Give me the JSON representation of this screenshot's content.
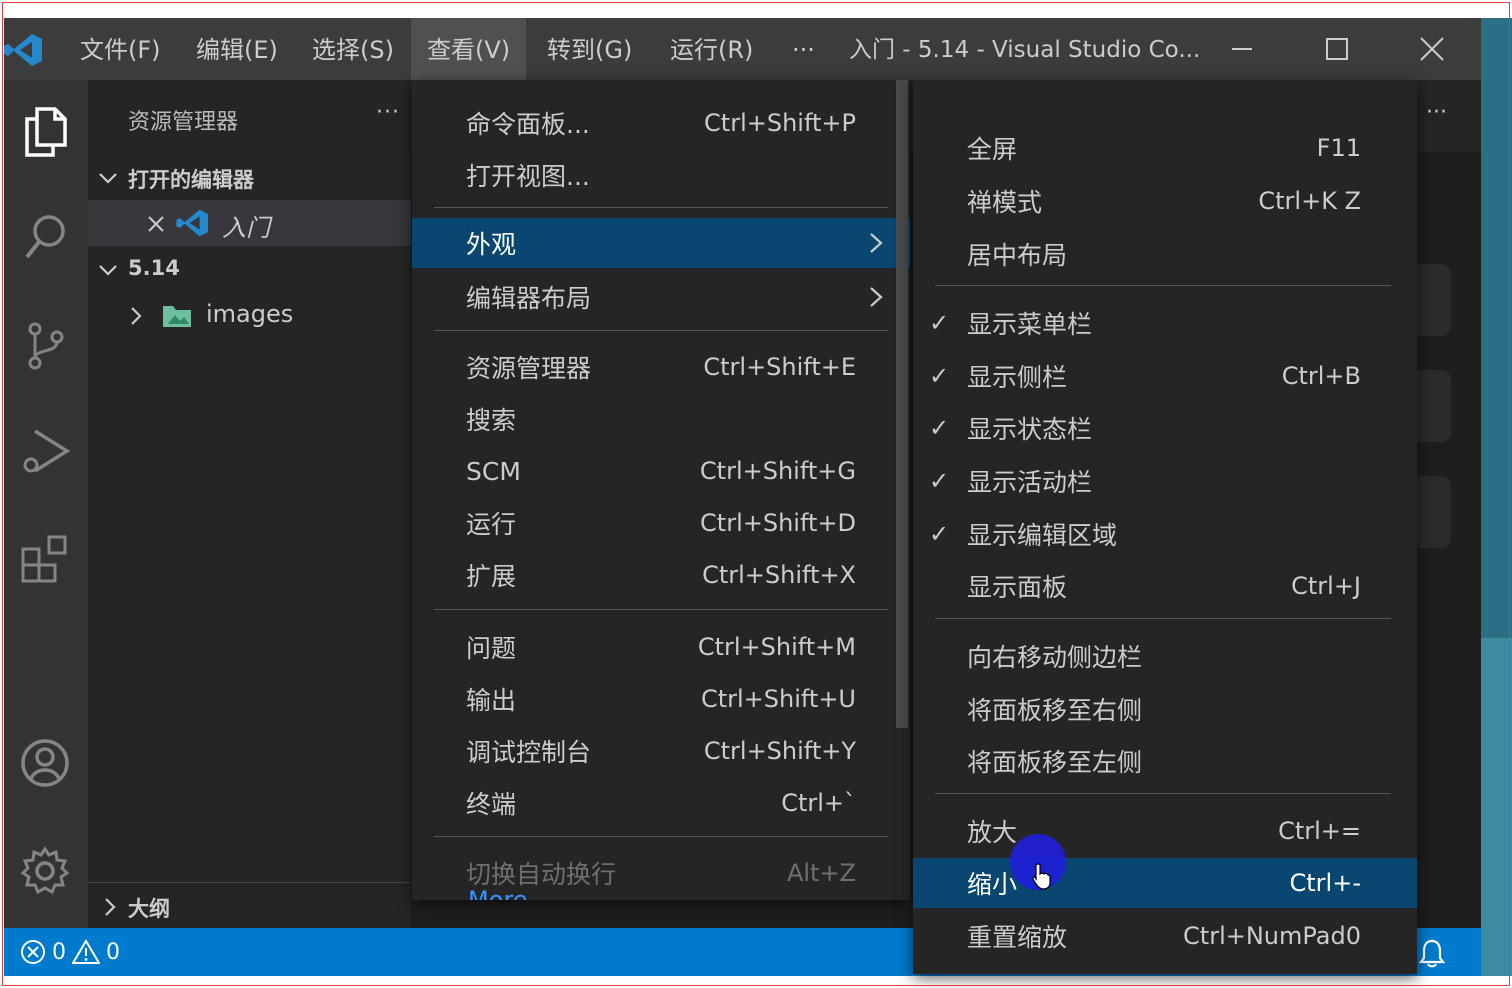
{
  "titlebar": {
    "menus": [
      "文件(F)",
      "编辑(E)",
      "选择(S)",
      "查看(V)",
      "转到(G)",
      "运行(R)"
    ],
    "overflow": "···",
    "title": "入门 - 5.14 - Visual Studio Co..."
  },
  "sidebar": {
    "title": "资源管理器",
    "more": "···",
    "open_editors_label": "打开的编辑器",
    "open_editor_file": "入门",
    "folder_label": "5.14",
    "tree_item": "images",
    "outline_label": "大纲"
  },
  "editor": {
    "more": "···"
  },
  "statusbar": {
    "errors": "0",
    "warnings": "0"
  },
  "view_menu": {
    "items": [
      {
        "label": "命令面板...",
        "key": "Ctrl+Shift+P"
      },
      {
        "label": "打开视图...",
        "key": ""
      },
      {
        "label": "外观",
        "key": "",
        "submenu": true,
        "highlighted": true
      },
      {
        "label": "编辑器布局",
        "key": "",
        "submenu": true
      },
      {
        "label": "资源管理器",
        "key": "Ctrl+Shift+E"
      },
      {
        "label": "搜索",
        "key": ""
      },
      {
        "label": "SCM",
        "key": "Ctrl+Shift+G"
      },
      {
        "label": "运行",
        "key": "Ctrl+Shift+D"
      },
      {
        "label": "扩展",
        "key": "Ctrl+Shift+X"
      },
      {
        "label": "问题",
        "key": "Ctrl+Shift+M"
      },
      {
        "label": "输出",
        "key": "Ctrl+Shift+U"
      },
      {
        "label": "调试控制台",
        "key": "Ctrl+Shift+Y"
      },
      {
        "label": "终端",
        "key": "Ctrl+`"
      },
      {
        "label": "切换自动换行",
        "key": "Alt+Z",
        "disabled": true
      }
    ],
    "peek_text": "More..."
  },
  "appearance_menu": {
    "items": [
      {
        "label": "全屏",
        "key": "F11",
        "checked": false
      },
      {
        "label": "禅模式",
        "key": "Ctrl+K Z",
        "checked": false
      },
      {
        "label": "居中布局",
        "key": "",
        "checked": false
      },
      {
        "label": "显示菜单栏",
        "key": "",
        "checked": true
      },
      {
        "label": "显示侧栏",
        "key": "Ctrl+B",
        "checked": true
      },
      {
        "label": "显示状态栏",
        "key": "",
        "checked": true
      },
      {
        "label": "显示活动栏",
        "key": "",
        "checked": true
      },
      {
        "label": "显示编辑区域",
        "key": "",
        "checked": true
      },
      {
        "label": "显示面板",
        "key": "Ctrl+J",
        "checked": false
      },
      {
        "label": "向右移动侧边栏",
        "key": "",
        "checked": false
      },
      {
        "label": "将面板移至右侧",
        "key": "",
        "checked": false
      },
      {
        "label": "将面板移至左侧",
        "key": "",
        "checked": false
      },
      {
        "label": "放大",
        "key": "Ctrl+=",
        "checked": false
      },
      {
        "label": "缩小",
        "key": "Ctrl+-",
        "checked": false,
        "highlighted": true
      },
      {
        "label": "重置缩放",
        "key": "Ctrl+NumPad0",
        "checked": false
      }
    ]
  },
  "colors": {
    "accent": "#007acc",
    "menu_highlight": "#094771",
    "titlebar": "#3c3c3c",
    "vscode_blue": "#2489ca"
  }
}
